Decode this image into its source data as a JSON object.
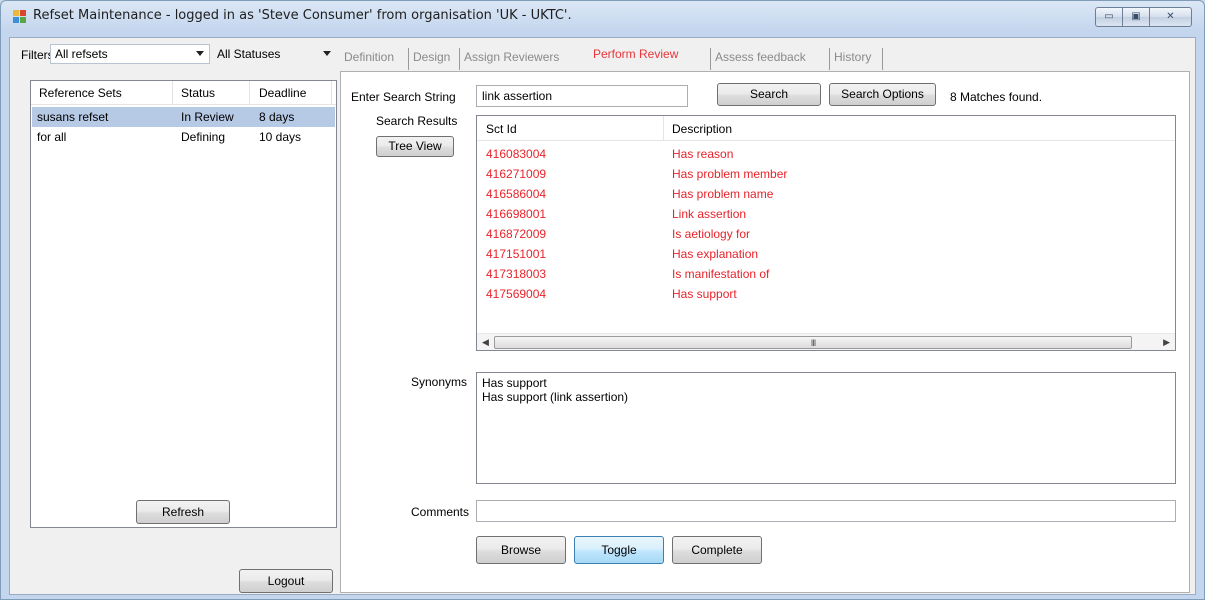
{
  "window": {
    "title": "Refset Maintenance - logged in as 'Steve Consumer' from organisation 'UK - UKTC'.",
    "minimize_glyph": "▭",
    "maximize_glyph": "▣",
    "close_glyph": "✕"
  },
  "filters": {
    "label": "Filters",
    "refset_filter": "All refsets",
    "status_filter": "All Statuses"
  },
  "refsets": {
    "columns": [
      "Reference Sets",
      "Status",
      "Deadline"
    ],
    "rows": [
      {
        "name": "susans refset",
        "status": "In Review",
        "deadline": "8 days",
        "selected": true
      },
      {
        "name": "for all",
        "status": "Defining",
        "deadline": "10 days",
        "selected": false
      }
    ]
  },
  "left_buttons": {
    "refresh": "Refresh",
    "logout": "Logout"
  },
  "tabs": [
    {
      "label": "Definition",
      "active": false
    },
    {
      "label": "Design",
      "active": false
    },
    {
      "label": "Assign Reviewers",
      "active": false
    },
    {
      "label": "Perform Review",
      "active": true
    },
    {
      "label": "Assess feedback",
      "active": false
    },
    {
      "label": "History",
      "active": false
    }
  ],
  "review": {
    "search_label": "Enter Search String",
    "search_value": "link assertion",
    "search_button": "Search",
    "search_options_button": "Search Options",
    "match_count": "8 Matches found.",
    "results_label": "Search Results",
    "tree_view_button": "Tree View",
    "columns": [
      "Sct Id",
      "Description"
    ],
    "results": [
      {
        "id": "416083004",
        "description": "Has reason"
      },
      {
        "id": "416271009",
        "description": "Has problem member"
      },
      {
        "id": "416586004",
        "description": "Has problem name"
      },
      {
        "id": "416698001",
        "description": "Link assertion"
      },
      {
        "id": "416872009",
        "description": "Is aetiology for"
      },
      {
        "id": "417151001",
        "description": "Has explanation"
      },
      {
        "id": "417318003",
        "description": "Is manifestation of"
      },
      {
        "id": "417569004",
        "description": "Has support"
      }
    ],
    "scroll_left": "◀",
    "scroll_right": "▶",
    "scroll_grip": "III",
    "synonyms_label": "Synonyms",
    "synonyms": [
      "Has support",
      "Has support (link assertion)"
    ],
    "comments_label": "Comments",
    "comments_value": "",
    "browse_button": "Browse",
    "toggle_button": "Toggle",
    "complete_button": "Complete"
  },
  "colors": {
    "result_text": "#e8232a",
    "active_tab": "#e8363b",
    "selection": "#b6c9e5"
  }
}
